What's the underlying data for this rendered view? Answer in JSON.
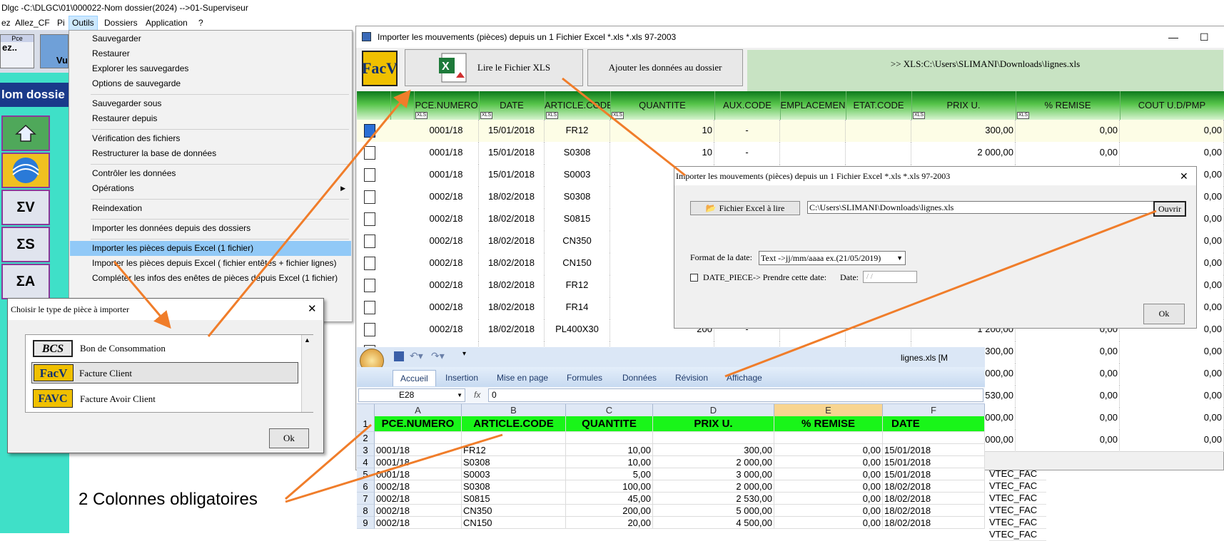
{
  "app": {
    "title": "Dlgc -C:\\DLGC\\01\\000022-Nom dossier(2024) -->01-Superviseur",
    "menu": [
      "ez",
      "Allez_CF",
      "Pi",
      "Outils",
      "Dossiers",
      "Application",
      "?"
    ],
    "toolbar_pce": "Pce",
    "toolbar_allez": "ez..",
    "toolbar_vu": "Vu",
    "name_bar": "lom dossie",
    "left_buttons": [
      "ΣV",
      "ΣS",
      "ΣA"
    ]
  },
  "outils_menu": {
    "items": [
      {
        "label": "Sauvegarder"
      },
      {
        "label": "Restaurer"
      },
      {
        "label": "Explorer les sauvegardes"
      },
      {
        "label": "Options de sauvegarde"
      },
      {
        "label": "Sauvegarder sous"
      },
      {
        "label": "Restaurer depuis"
      },
      {
        "label": "Vérification des fichiers"
      },
      {
        "label": "Restructurer la base de données"
      },
      {
        "label": "Contrôler les données"
      },
      {
        "label": "Opérations"
      },
      {
        "label": "Reindexation"
      },
      {
        "label": "Importer les données depuis des dossiers"
      },
      {
        "label": "Importer les pièces depuis Excel (1 fichier)"
      },
      {
        "label": "Importer les pièces depuis Excel ( fichier entêtes + fichier lignes)"
      },
      {
        "label": "Compléter les infos des enêtes de pièces depuis Excel (1 fichier)"
      }
    ]
  },
  "import_window": {
    "title": "Importer les mouvements (pièces) depuis un 1 Fichier Excel *.xls *.xls 97-2003",
    "minimize": "—",
    "maximize": "☐",
    "facv_logo": "FacV",
    "read_button": "Lire le Fichier XLS",
    "add_button": "Ajouter les données au dossier",
    "path_label": ">> XLS:C:\\Users\\SLIMANI\\Downloads\\lignes.xls",
    "xls_mark": "XLS",
    "columns": [
      "PCE.NUMERO",
      "DATE",
      "ARTICLE.CODE",
      "QUANTITE",
      "AUX.CODE",
      "EMPLACEMEN",
      "ETAT.CODE",
      "PRIX U.",
      "% REMISE",
      "COUT U.D/PMP"
    ],
    "rows": [
      {
        "num": "0001/18",
        "date": "15/01/2018",
        "code": "FR12",
        "qte": "10",
        "aux": "-",
        "prix": "300,00",
        "remise": "0,00",
        "cout": "0,00"
      },
      {
        "num": "0001/18",
        "date": "15/01/2018",
        "code": "S0308",
        "qte": "10",
        "aux": "-",
        "prix": "2 000,00",
        "remise": "0,00",
        "cout": "0,00"
      },
      {
        "num": "0001/18",
        "date": "15/01/2018",
        "code": "S0003",
        "qte": "",
        "aux": "",
        "prix": "",
        "remise": "",
        "cout": "0,00"
      },
      {
        "num": "0002/18",
        "date": "18/02/2018",
        "code": "S0308",
        "qte": "",
        "aux": "",
        "prix": "",
        "remise": "",
        "cout": "0,00"
      },
      {
        "num": "0002/18",
        "date": "18/02/2018",
        "code": "S0815",
        "qte": "",
        "aux": "",
        "prix": "",
        "remise": "",
        "cout": "0,00"
      },
      {
        "num": "0002/18",
        "date": "18/02/2018",
        "code": "CN350",
        "qte": "",
        "aux": "",
        "prix": "",
        "remise": "",
        "cout": "0,00"
      },
      {
        "num": "0002/18",
        "date": "18/02/2018",
        "code": "CN150",
        "qte": "",
        "aux": "",
        "prix": "",
        "remise": "",
        "cout": "0,00"
      },
      {
        "num": "0002/18",
        "date": "18/02/2018",
        "code": "FR12",
        "qte": "",
        "aux": "",
        "prix": "",
        "remise": "",
        "cout": "0,00"
      },
      {
        "num": "0002/18",
        "date": "18/02/2018",
        "code": "FR14",
        "qte": "",
        "aux": "",
        "prix": "",
        "remise": "",
        "cout": "0,00"
      },
      {
        "num": "0002/18",
        "date": "18/02/2018",
        "code": "PL400X30",
        "qte": "200",
        "aux": "-",
        "prix": "1 200,00",
        "remise": "0,00",
        "cout": "0,00"
      },
      {
        "num": "",
        "date": "",
        "code": "",
        "qte": "",
        "aux": "",
        "prix": "300,00",
        "remise": "0,00",
        "cout": "0,00"
      },
      {
        "num": "",
        "date": "",
        "code": "",
        "qte": "",
        "aux": "",
        "prix": "000,00",
        "remise": "0,00",
        "cout": "0,00"
      },
      {
        "num": "",
        "date": "",
        "code": "",
        "qte": "",
        "aux": "",
        "prix": "530,00",
        "remise": "0,00",
        "cout": "0,00"
      },
      {
        "num": "",
        "date": "",
        "code": "",
        "qte": "",
        "aux": "",
        "prix": "000,00",
        "remise": "0,00",
        "cout": "0,00"
      },
      {
        "num": "",
        "date": "",
        "code": "",
        "qte": "",
        "aux": "",
        "prix": "000,00",
        "remise": "0,00",
        "cout": "0,00"
      }
    ]
  },
  "sub_dialog": {
    "title": "Importer les mouvements (pièces) depuis un 1 Fichier Excel *.xls *.xls 97-2003",
    "close": "✕",
    "file_button": "Fichier Excel à lire",
    "file_path": "C:\\Users\\SLIMANI\\Downloads\\lignes.xls",
    "open_button": "Ouvrir",
    "date_format_label": "Format de la date:",
    "date_format_value": "Text ->jj/mm/aaaa ex.(21/05/2019)",
    "date_piece_label": "DATE_PIECE-> Prendre cette date:",
    "date_label": "Date:",
    "date_placeholder": "/ /",
    "ok_button": "Ok"
  },
  "type_dialog": {
    "title": "Choisir le type de pièce à importer",
    "close": "✕",
    "items": [
      {
        "logo": "BCS",
        "label": "Bon de Consommation"
      },
      {
        "logo": "FacV",
        "label": "Facture Client"
      },
      {
        "logo": "FAVC",
        "label": "Facture Avoir Client"
      }
    ],
    "ok_button": "Ok"
  },
  "excel": {
    "file_title": "lignes.xls  [M",
    "tabs": [
      "Accueil",
      "Insertion",
      "Mise en page",
      "Formules",
      "Données",
      "Révision",
      "Affichage"
    ],
    "cell_ref": "E28",
    "formula_value": "0",
    "fx": "fx",
    "col_letters": [
      "A",
      "B",
      "C",
      "D",
      "E",
      "F"
    ],
    "header_row": [
      "PCE.NUMERO",
      "ARTICLE.CODE",
      "QUANTITE",
      "PRIX U.",
      "% REMISE",
      "DATE"
    ],
    "rows": [
      {
        "n": "2",
        "cells": [
          "",
          "",
          "",
          "",
          "",
          ""
        ]
      },
      {
        "n": "3",
        "cells": [
          "0001/18",
          "FR12",
          "10,00",
          "300,00",
          "0,00",
          "15/01/2018"
        ]
      },
      {
        "n": "4",
        "cells": [
          "0001/18",
          "S0308",
          "10,00",
          "2 000,00",
          "0,00",
          "15/01/2018"
        ]
      },
      {
        "n": "5",
        "cells": [
          "0001/18",
          "S0003",
          "5,00",
          "3 000,00",
          "0,00",
          "15/01/2018"
        ]
      },
      {
        "n": "6",
        "cells": [
          "0002/18",
          "S0308",
          "100,00",
          "2 000,00",
          "0,00",
          "18/02/2018"
        ]
      },
      {
        "n": "7",
        "cells": [
          "0002/18",
          "S0815",
          "45,00",
          "2 530,00",
          "0,00",
          "18/02/2018"
        ]
      },
      {
        "n": "8",
        "cells": [
          "0002/18",
          "CN350",
          "200,00",
          "5 000,00",
          "0,00",
          "18/02/2018"
        ]
      },
      {
        "n": "9",
        "cells": [
          "0002/18",
          "CN150",
          "20,00",
          "4 500,00",
          "0,00",
          "18/02/2018"
        ]
      }
    ],
    "extra_col": [
      "VTEC_FAC",
      "VTEC_FAC",
      "VTEC_FAC",
      "VTEC_FAC",
      "VTEC_FAC",
      "VTEC_FAC"
    ],
    "row1_n": "1"
  },
  "callout": "2 Colonnes obligatoires",
  "colors": {
    "accent_arrow": "#f07d2a",
    "grid_header": "#2e9b2e",
    "excel_header": "#19f519",
    "menu_highlight": "#91c9f7"
  }
}
